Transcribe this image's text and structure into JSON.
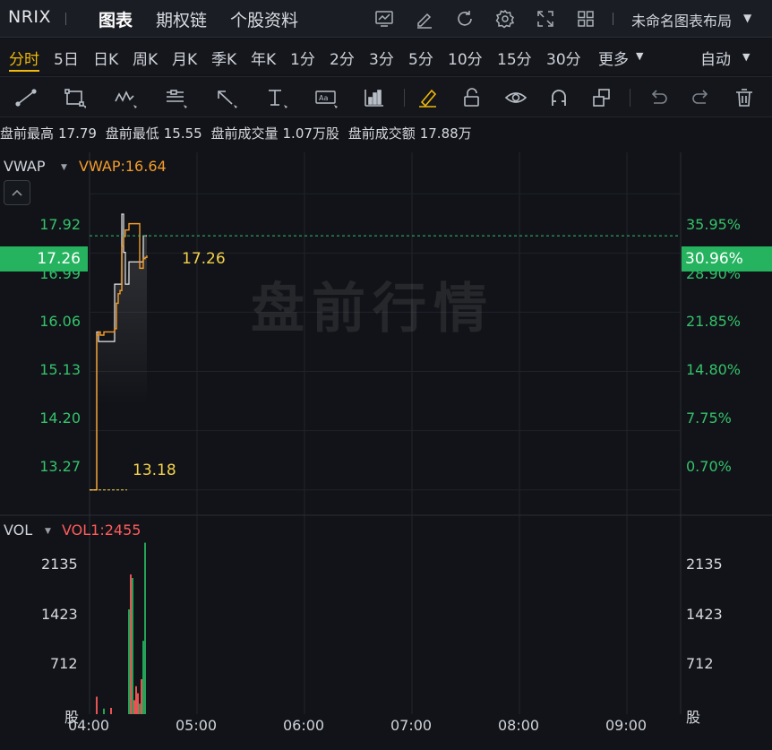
{
  "header": {
    "ticker": "NRIX",
    "tabs": [
      {
        "label": "图表",
        "active": true
      },
      {
        "label": "期权链",
        "active": false
      },
      {
        "label": "个股资料",
        "active": false
      }
    ],
    "layout_name": "未命名图表布局",
    "icons": [
      "chart-icon",
      "pencil-icon",
      "refresh-icon",
      "gear-icon",
      "fullscreen-icon",
      "grid-icon"
    ]
  },
  "periods": {
    "items": [
      "分时",
      "5日",
      "日K",
      "周K",
      "月K",
      "季K",
      "年K",
      "1分",
      "2分",
      "3分",
      "5分",
      "10分",
      "15分",
      "30分",
      "更多"
    ],
    "active": "分时",
    "scale_mode": "自动"
  },
  "draw_tools": [
    "trendline-icon",
    "rectangle-icon",
    "pattern-icon",
    "fibonacci-icon",
    "arrow-icon",
    "text-marker-icon",
    "annotation-icon",
    "indicator-icon",
    "highlighter-icon",
    "lock-icon",
    "eye-icon",
    "magnet-icon",
    "layers-icon",
    "undo-icon",
    "redo-icon",
    "trash-icon"
  ],
  "premarket": {
    "high_label": "盘前最高",
    "high": "17.79",
    "low_label": "盘前最低",
    "low": "15.55",
    "volume_label": "盘前成交量",
    "volume": "1.07万股",
    "turnover_label": "盘前成交额",
    "turnover": "17.88万"
  },
  "price_panel": {
    "indicator": "VWAP",
    "indicator_value": "VWAP:16.64",
    "watermark": "盘前行情",
    "last_price": "17.26",
    "last_pct": "30.96%",
    "low_marker": "13.18",
    "left_ticks": [
      "17.92",
      "16.99",
      "16.06",
      "15.13",
      "14.20",
      "13.27"
    ],
    "right_ticks": [
      "35.95%",
      "28.90%",
      "21.85%",
      "14.80%",
      "7.75%",
      "0.70%"
    ]
  },
  "volume_panel": {
    "indicator": "VOL",
    "indicator_value": "VOL1:2455",
    "left_ticks": [
      "2135",
      "1423",
      "712",
      "股"
    ],
    "right_ticks": [
      "2135",
      "1423",
      "712",
      "股"
    ]
  },
  "time_axis": [
    "04:00",
    "05:00",
    "06:00",
    "07:00",
    "08:00",
    "09:00"
  ],
  "colors": {
    "up": "#26b35f",
    "down": "#ff5b5b",
    "vwap": "#f39c2c",
    "price_line": "#e8e8e8",
    "accent": "#f0b90b"
  },
  "chart_data": {
    "type": "line",
    "title": "",
    "xlabel": "",
    "ylabel": "",
    "ylim": [
      12.9,
      18.5
    ],
    "x_range": [
      "04:00",
      "09:30"
    ],
    "price": {
      "name": "",
      "x": [
        "04:00",
        "04:02",
        "04:03",
        "04:04",
        "04:05",
        "04:06",
        "04:08",
        "04:10",
        "04:12",
        "04:13",
        "04:14",
        "04:15",
        "04:16",
        "04:17",
        "04:18",
        "04:19",
        "04:20",
        "04:21",
        "04:22",
        "04:23",
        "04:24",
        "04:25",
        "04:26",
        "04:27",
        "04:28",
        "04:29",
        "04:30",
        "04:31",
        "04:32"
      ],
      "y": [
        13.27,
        13.27,
        13.27,
        15.75,
        15.6,
        15.6,
        15.6,
        15.6,
        15.6,
        15.6,
        16.5,
        16.5,
        16.5,
        16.5,
        17.6,
        17.0,
        16.5,
        16.5,
        16.85,
        16.85,
        16.85,
        16.85,
        16.85,
        16.85,
        16.85,
        16.85,
        17.26,
        17.26,
        17.26
      ]
    },
    "vwap": {
      "name": "VWAP",
      "x": [
        "04:00",
        "04:02",
        "04:03",
        "04:04",
        "04:05",
        "04:06",
        "04:08",
        "04:10",
        "04:12",
        "04:13",
        "04:14",
        "04:15",
        "04:16",
        "04:17",
        "04:18",
        "04:19",
        "04:20",
        "04:21",
        "04:22",
        "04:23",
        "04:24",
        "04:25",
        "04:26",
        "04:27",
        "04:28",
        "04:29",
        "04:30",
        "04:31",
        "04:32"
      ],
      "y": [
        13.27,
        13.27,
        13.27,
        15.7,
        15.75,
        15.7,
        15.75,
        15.75,
        15.75,
        15.75,
        15.8,
        16.2,
        16.35,
        16.4,
        17.1,
        17.25,
        17.35,
        17.35,
        17.45,
        17.45,
        17.45,
        17.45,
        17.45,
        17.45,
        16.75,
        16.75,
        16.9,
        16.92,
        16.95
      ]
    },
    "volume": {
      "x": [
        4,
        5,
        6,
        7,
        8,
        9,
        10,
        11,
        12,
        13,
        14,
        15,
        16,
        17,
        18,
        19,
        20,
        21,
        22,
        23,
        24,
        25,
        26,
        27,
        28,
        29,
        30,
        31
      ],
      "values": [
        250,
        0,
        0,
        0,
        80,
        0,
        0,
        0,
        90,
        0,
        0,
        0,
        0,
        0,
        0,
        0,
        0,
        0,
        1500,
        2000,
        1950,
        200,
        400,
        300,
        150,
        500,
        1050,
        2455
      ],
      "colors": [
        "down",
        "down",
        "down",
        "down",
        "up",
        "up",
        "up",
        "up",
        "down",
        "down",
        "down",
        "down",
        "down",
        "down",
        "down",
        "down",
        "down",
        "down",
        "up",
        "down",
        "up",
        "down",
        "down",
        "down",
        "up",
        "down",
        "up",
        "up"
      ]
    },
    "volume_ylim": [
      0,
      2848
    ]
  }
}
